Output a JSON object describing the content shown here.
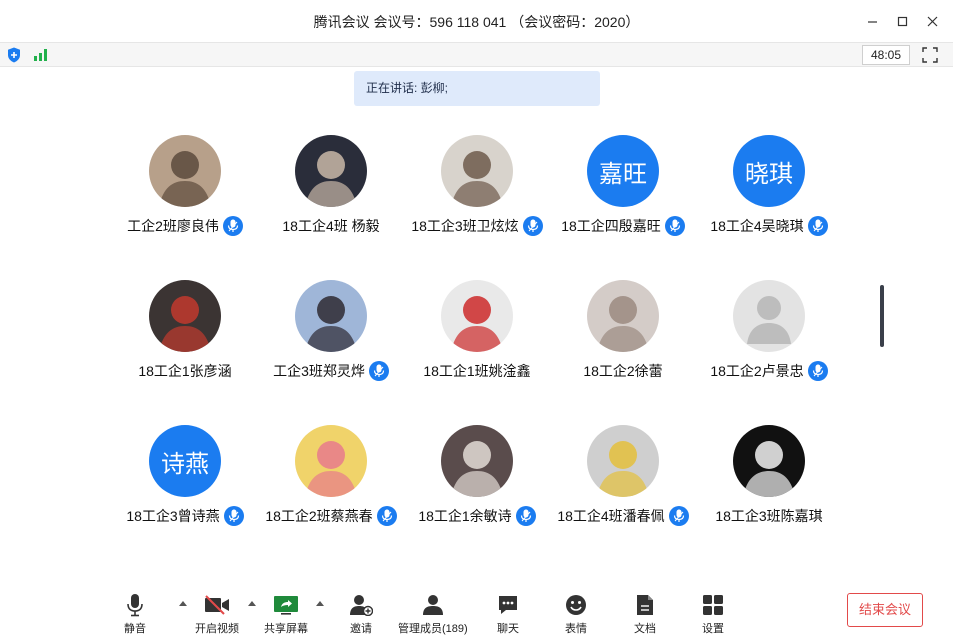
{
  "window": {
    "title": "腾讯会议 会议号：596 118 041 （会议密码：2020）"
  },
  "status": {
    "timer": "48:05"
  },
  "speaking": {
    "text": "正在讲话: 彭柳;"
  },
  "participants": [
    {
      "name": "工企2班廖良伟",
      "avatar": "photo",
      "mic": true
    },
    {
      "name": "18工企4班 杨毅",
      "avatar": "photo",
      "mic": false
    },
    {
      "name": "18工企3班卫炫炫",
      "avatar": "photo",
      "mic": true
    },
    {
      "name": "18工企四殷嘉旺",
      "avatar": "text",
      "initials": "嘉旺",
      "mic": true
    },
    {
      "name": "18工企4吴晓琪",
      "avatar": "text",
      "initials": "晓琪",
      "mic": true
    },
    {
      "name": "18工企1张彦涵",
      "avatar": "photo",
      "mic": false
    },
    {
      "name": "工企3班郑灵烨",
      "avatar": "photo",
      "mic": true
    },
    {
      "name": "18工企1班姚淦鑫",
      "avatar": "photo",
      "mic": false
    },
    {
      "name": "18工企2徐蕾",
      "avatar": "photo",
      "mic": false
    },
    {
      "name": "18工企2卢景忠",
      "avatar": "default",
      "mic": true
    },
    {
      "name": "18工企3曾诗燕",
      "avatar": "text",
      "initials": "诗燕",
      "mic": true
    },
    {
      "name": "18工企2班蔡燕春",
      "avatar": "photo",
      "mic": true
    },
    {
      "name": "18工企1余敏诗",
      "avatar": "photo",
      "mic": true
    },
    {
      "name": "18工企4班潘春佩",
      "avatar": "photo",
      "mic": true
    },
    {
      "name": "18工企3班陈嘉琪",
      "avatar": "photo",
      "mic": false
    }
  ],
  "toolbar": {
    "mute": "静音",
    "video": "开启视频",
    "share": "共享屏幕",
    "invite": "邀请",
    "members": "管理成员(189)",
    "chat": "聊天",
    "emoji": "表情",
    "docs": "文档",
    "settings": "设置",
    "end": "结束会议"
  },
  "colors": {
    "accent": "#1b7cf0",
    "danger": "#e24a4a",
    "banner": "#dfeafb"
  }
}
